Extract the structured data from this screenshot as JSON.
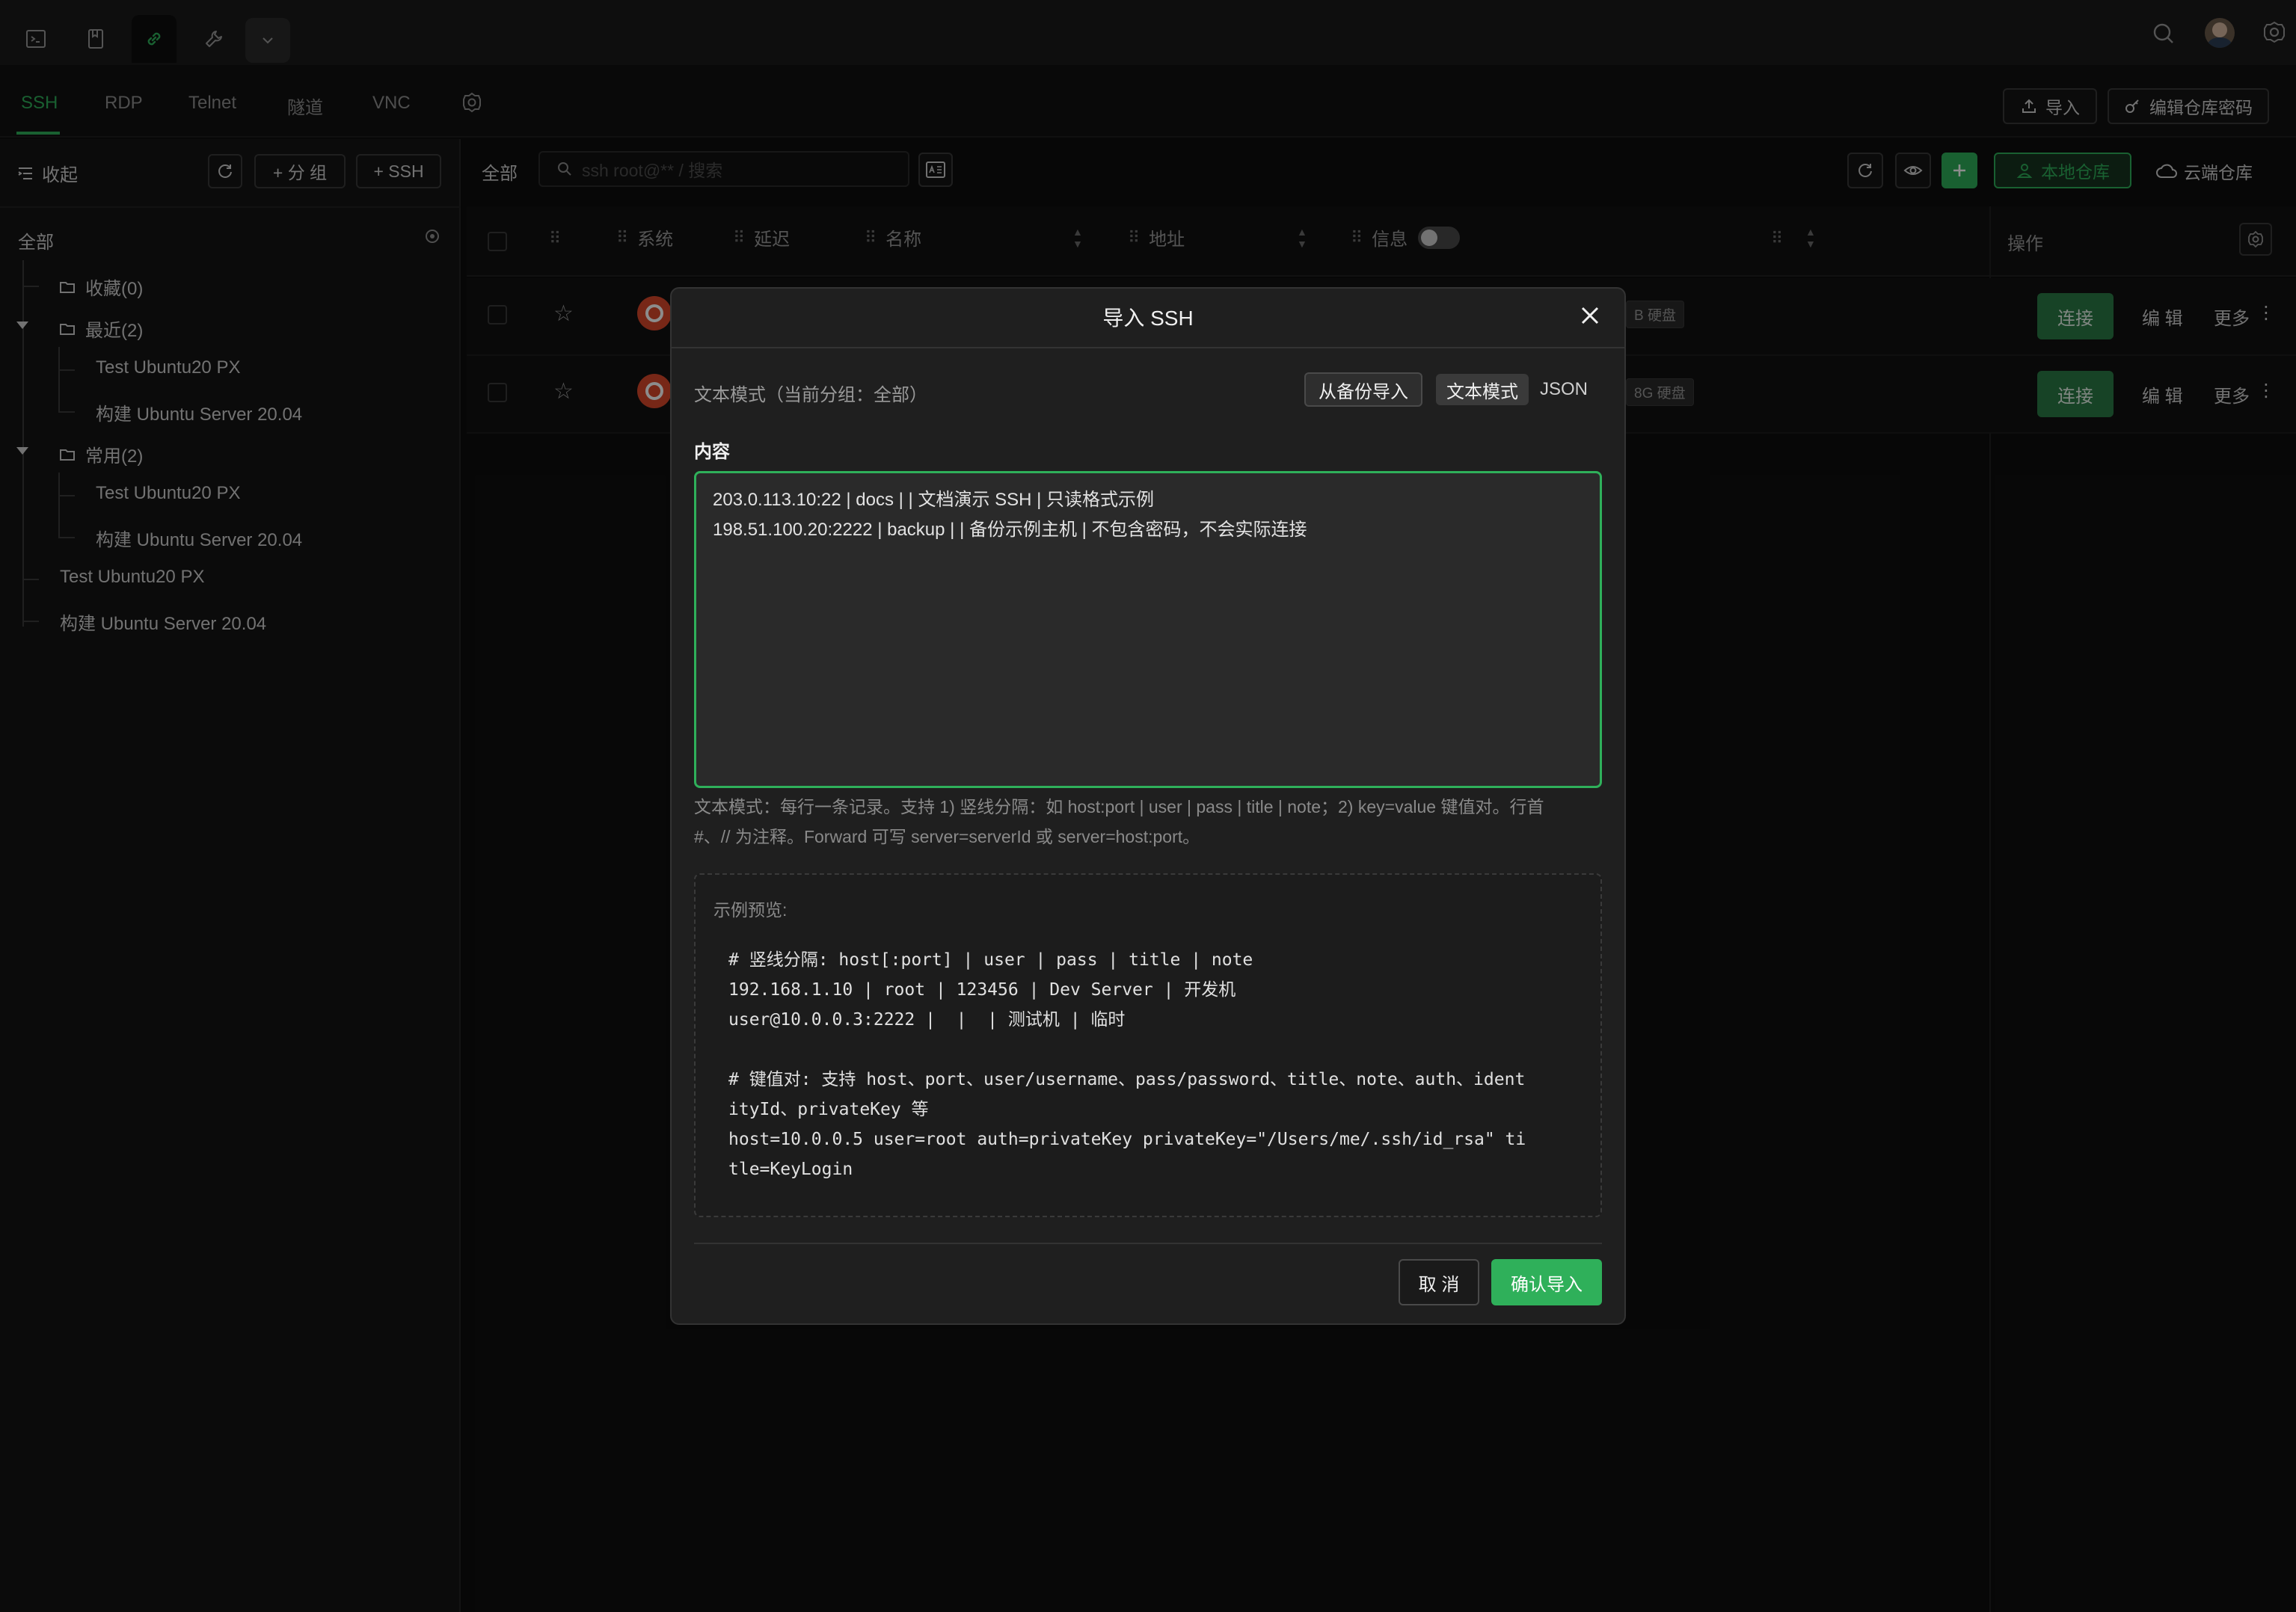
{
  "topbar": {
    "icons": [
      "terminal-icon",
      "bookmark-icon",
      "link-icon",
      "wrench-icon",
      "chevron-down-icon",
      "search-icon",
      "avatar",
      "settings-icon"
    ]
  },
  "protocol_tabs": [
    "SSH",
    "RDP",
    "Telnet",
    "隧道",
    "VNC"
  ],
  "header_actions": {
    "import_label": "导入",
    "edit_repo_password_label": "编辑仓库密码"
  },
  "sidebar": {
    "collapse_label": "收起",
    "add_group_label": "+ 分 组",
    "add_ssh_label": "+ SSH",
    "root_label": "全部",
    "tree": {
      "favorites": "收藏(0)",
      "recent": "最近(2)",
      "recent_items": [
        "Test Ubuntu20 PX",
        "构建 Ubuntu Server 20.04"
      ],
      "common": "常用(2)",
      "common_items": [
        "Test Ubuntu20 PX",
        "构建 Ubuntu Server 20.04"
      ],
      "root_items": [
        "Test Ubuntu20 PX",
        "构建 Ubuntu Server 20.04"
      ]
    }
  },
  "main": {
    "filter_label": "全部",
    "search_placeholder": "ssh root@** / 搜索",
    "local_repo_label": "本地仓库",
    "cloud_repo_label": "云端仓库",
    "columns": {
      "system": "系统",
      "latency": "延迟",
      "name": "名称",
      "address": "地址",
      "info": "信息",
      "actions": "操作"
    },
    "rows": [
      {
        "disk_badge": "B 硬盘",
        "connect": "连接",
        "edit": "编 辑",
        "more": "更多"
      },
      {
        "disk_badge": "8G 硬盘",
        "connect": "连接",
        "edit": "编 辑",
        "more": "更多"
      }
    ]
  },
  "modal": {
    "title": "导入 SSH",
    "mode_hint": "文本模式（当前分组：全部）",
    "from_backup_label": "从备份导入",
    "text_mode_label": "文本模式",
    "json_label": "JSON",
    "content_label": "内容",
    "content_value": "203.0.113.10:22 | docs | | 文档演示 SSH | 只读格式示例\n198.51.100.20:2222 | backup | | 备份示例主机 | 不包含密码，不会实际连接",
    "help_line1": "文本模式：每行一条记录。支持 1) 竖线分隔：如 host:port | user | pass | title | note；2) key=value 键值对。行首",
    "help_line2": "#、// 为注释。Forward 可写 server=serverId 或 server=host:port。",
    "preview_label": "示例预览:",
    "preview_lines": [
      "# 竖线分隔: host[:port] | user | pass | title | note",
      "192.168.1.10 | root | 123456 | Dev Server | 开发机",
      "user@10.0.0.3:2222 |  |  | 测试机 | 临时",
      "",
      "# 键值对: 支持 host、port、user/username、pass/password、title、note、auth、ident",
      "ityId、privateKey 等",
      "host=10.0.0.5 user=root auth=privateKey privateKey=\"/Users/me/.ssh/id_rsa\" ti",
      "tle=KeyLogin"
    ],
    "cancel_label": "取 消",
    "confirm_label": "确认导入"
  },
  "colors": {
    "accent": "#2fb05a",
    "accent_dark": "#2b7a45",
    "background": "#0e0e0e"
  }
}
